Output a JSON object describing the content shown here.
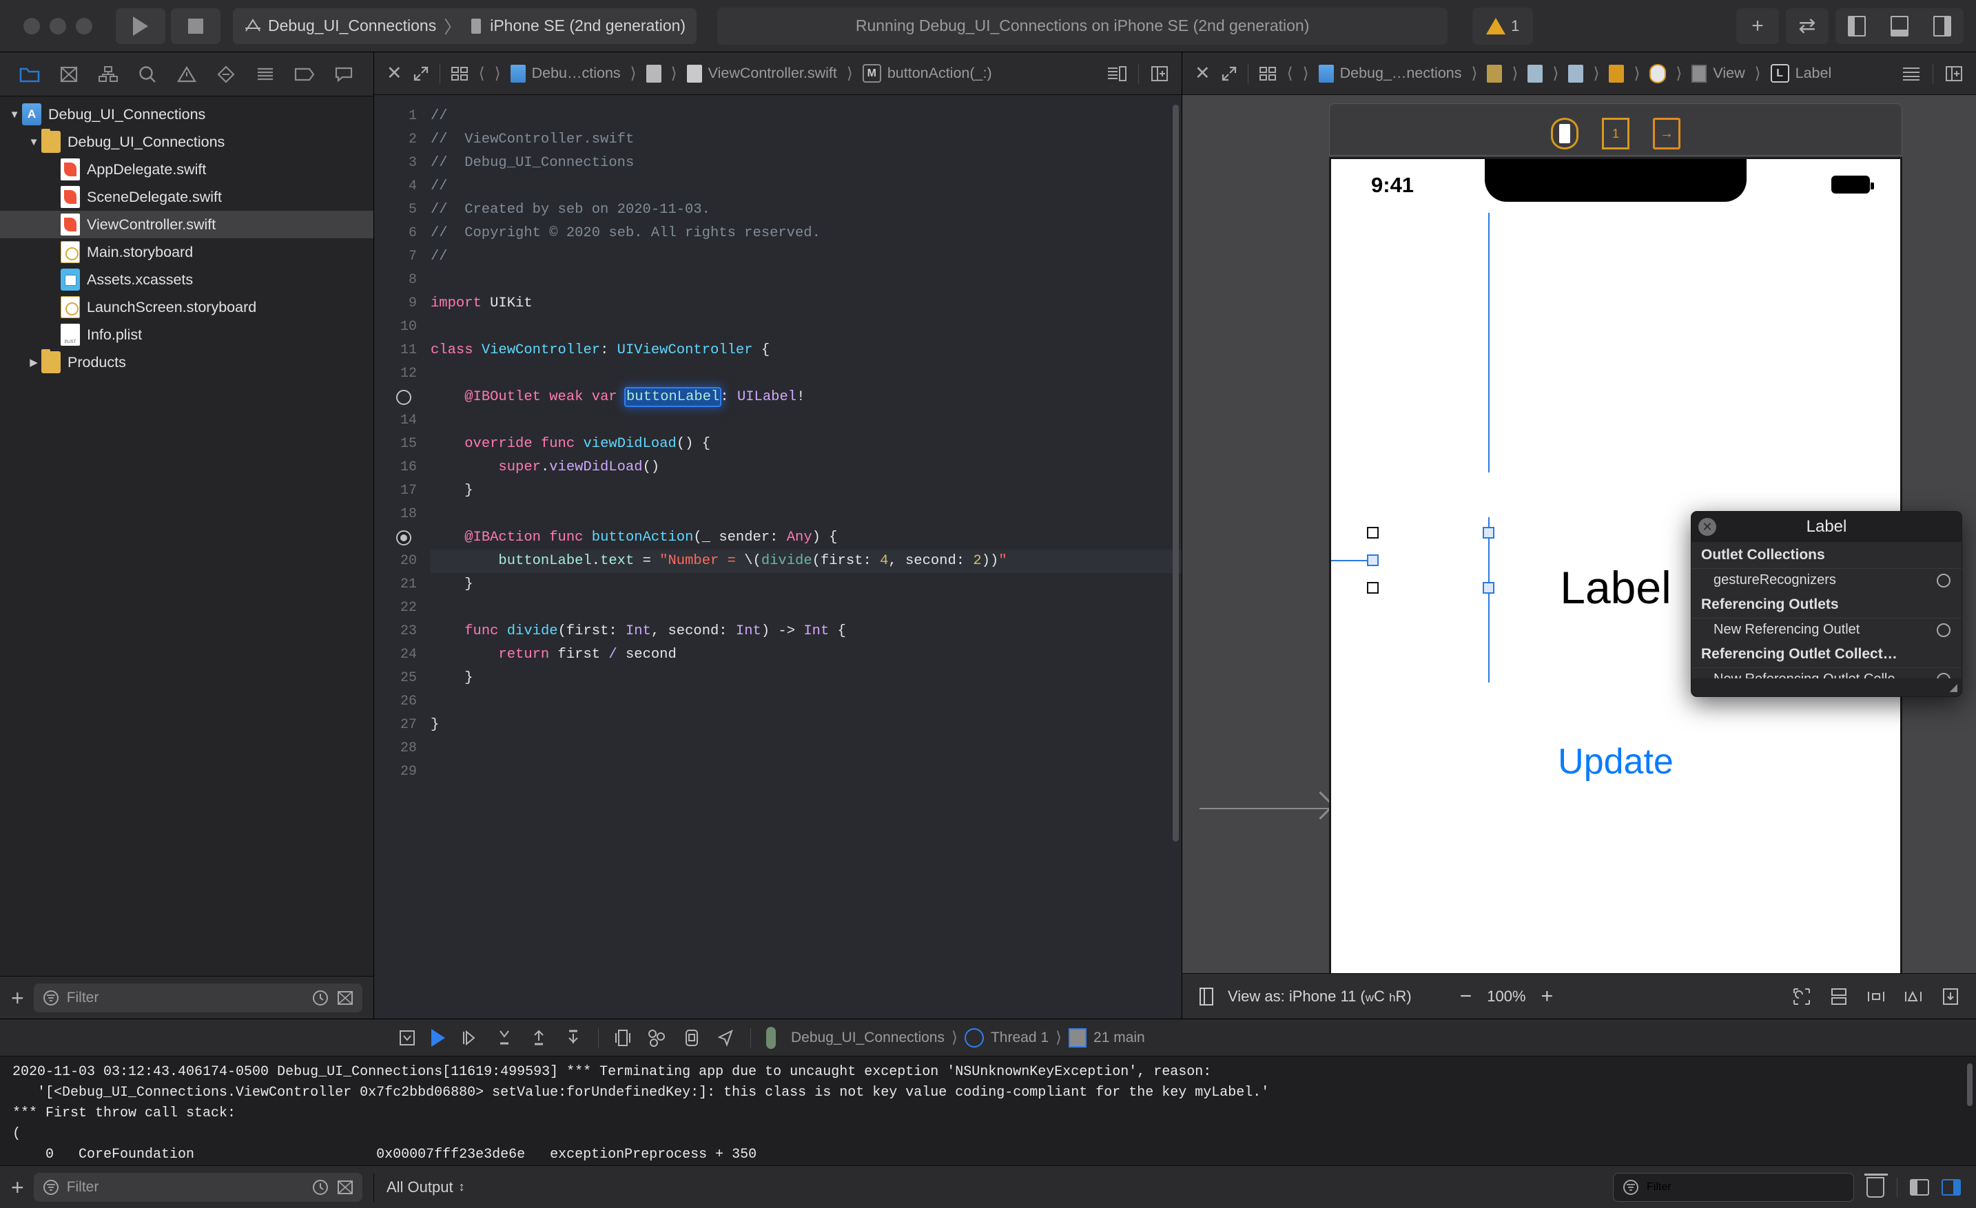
{
  "toolbar": {
    "run_icon": "play-icon",
    "stop_icon": "stop-icon",
    "scheme_name": "Debug_UI_Connections",
    "scheme_separator": "〉",
    "destination": "iPhone SE (2nd generation)",
    "status_text": "Running Debug_UI_Connections on iPhone SE (2nd generation)",
    "warning_count": "1",
    "add_label": "+",
    "swap_label": "⇄",
    "panes": [
      "left-pane-toggle",
      "bottom-pane-toggle",
      "right-pane-toggle"
    ]
  },
  "navigator": {
    "tabs": [
      "project-navigator-icon",
      "source-control-navigator-icon",
      "symbol-navigator-icon",
      "find-navigator-icon",
      "issue-navigator-icon",
      "test-navigator-icon",
      "debug-navigator-icon",
      "breakpoint-navigator-icon",
      "report-navigator-icon"
    ],
    "active_tab_index": 0,
    "tree": [
      {
        "label": "Debug_UI_Connections",
        "icon": "project-icon",
        "depth": 0,
        "disclosure": "▼",
        "selected": false
      },
      {
        "label": "Debug_UI_Connections",
        "icon": "folder-icon",
        "depth": 1,
        "disclosure": "▼",
        "selected": false
      },
      {
        "label": "AppDelegate.swift",
        "icon": "swift-file-icon",
        "depth": 2,
        "disclosure": "",
        "selected": false
      },
      {
        "label": "SceneDelegate.swift",
        "icon": "swift-file-icon",
        "depth": 2,
        "disclosure": "",
        "selected": false
      },
      {
        "label": "ViewController.swift",
        "icon": "swift-file-icon",
        "depth": 2,
        "disclosure": "",
        "selected": true
      },
      {
        "label": "Main.storyboard",
        "icon": "storyboard-icon",
        "depth": 2,
        "disclosure": "",
        "selected": false
      },
      {
        "label": "Assets.xcassets",
        "icon": "assets-icon",
        "depth": 2,
        "disclosure": "",
        "selected": false
      },
      {
        "label": "LaunchScreen.storyboard",
        "icon": "storyboard-icon",
        "depth": 2,
        "disclosure": "",
        "selected": false
      },
      {
        "label": "Info.plist",
        "icon": "plist-icon",
        "depth": 2,
        "disclosure": "",
        "selected": false
      },
      {
        "label": "Products",
        "icon": "folder-icon",
        "depth": 1,
        "disclosure": "▶",
        "selected": false
      }
    ],
    "footer": {
      "add_label": "+",
      "filter_placeholder": "Filter"
    }
  },
  "editor": {
    "jumpbar": {
      "close_label": "✕",
      "crumbs": [
        "Debu…ctions",
        "",
        "ViewController.swift",
        "buttonAction(_:)"
      ],
      "member_badge": "M"
    },
    "gutter_markers": {
      "ibo_line": 13,
      "iba_line": 19
    },
    "highlight_line": 20,
    "lines": [
      {
        "n": "1",
        "t": "//"
      },
      {
        "n": "2",
        "t": "//  ViewController.swift"
      },
      {
        "n": "3",
        "t": "//  Debug_UI_Connections"
      },
      {
        "n": "4",
        "t": "//"
      },
      {
        "n": "5",
        "t": "//  Created by seb on 2020-11-03."
      },
      {
        "n": "6",
        "t": "//  Copyright © 2020 seb. All rights reserved."
      },
      {
        "n": "7",
        "t": "//"
      },
      {
        "n": "8",
        "t": ""
      },
      {
        "n": "9",
        "t": "import UIKit"
      },
      {
        "n": "10",
        "t": ""
      },
      {
        "n": "11",
        "t": "class ViewController: UIViewController {"
      },
      {
        "n": "12",
        "t": ""
      },
      {
        "n": "13",
        "t": "    @IBOutlet weak var buttonLabel: UILabel!"
      },
      {
        "n": "14",
        "t": ""
      },
      {
        "n": "15",
        "t": "    override func viewDidLoad() {"
      },
      {
        "n": "16",
        "t": "        super.viewDidLoad()"
      },
      {
        "n": "17",
        "t": "    }"
      },
      {
        "n": "18",
        "t": ""
      },
      {
        "n": "19",
        "t": "    @IBAction func buttonAction(_ sender: Any) {"
      },
      {
        "n": "20",
        "t": "        buttonLabel.text = \"Number = \\(divide(first: 4, second: 2))\""
      },
      {
        "n": "21",
        "t": "    }"
      },
      {
        "n": "22",
        "t": ""
      },
      {
        "n": "23",
        "t": "    func divide(first: Int, second: Int) -> Int {"
      },
      {
        "n": "24",
        "t": "        return first / second"
      },
      {
        "n": "25",
        "t": "    }"
      },
      {
        "n": "26",
        "t": ""
      },
      {
        "n": "27",
        "t": "}"
      },
      {
        "n": "28",
        "t": ""
      },
      {
        "n": "29",
        "t": ""
      }
    ],
    "selected_token": "buttonLabel"
  },
  "interface_builder": {
    "jumpbar": {
      "close_label": "✕",
      "crumbs": [
        "Debug_…nections",
        "",
        "",
        "",
        "",
        "",
        "View",
        "Label"
      ],
      "label_badge": "L"
    },
    "scene_icons": [
      "view-controller-icon",
      "first-responder-icon",
      "exit-icon"
    ],
    "device": {
      "time": "9:41",
      "label_text": "Label",
      "button_text": "Update"
    },
    "bottom": {
      "view_as": "View as: iPhone 11 (",
      "view_as_w": "w",
      "view_as_c": "C",
      "view_as_h": "h",
      "view_as_r": "R)",
      "zoom_out": "−",
      "zoom_value": "100%",
      "zoom_in": "+"
    },
    "popover": {
      "title": "Label",
      "close_icon": "close-icon",
      "groups": [
        {
          "heading": "Outlet Collections",
          "items": [
            {
              "label": "gestureRecognizers"
            }
          ]
        },
        {
          "heading": "Referencing Outlets",
          "items": [
            {
              "label": "New Referencing Outlet"
            }
          ]
        },
        {
          "heading": "Referencing Outlet Collect…",
          "items": [
            {
              "label": "New Referencing Outlet Colle…"
            }
          ]
        }
      ]
    }
  },
  "debug": {
    "toolbar": {
      "icons": [
        "hide-debug-icon",
        "continue-icon",
        "step-over-icon",
        "step-into-icon",
        "step-out-icon",
        "step-out-of-icon",
        "view-debug-icon",
        "memory-graph-icon",
        "simulate-location-icon"
      ],
      "process": "Debug_UI_Connections",
      "thread": "Thread 1",
      "frame": "21 main"
    },
    "console_lines": [
      "2020-11-03 03:12:43.406174-0500 Debug_UI_Connections[11619:499593] *** Terminating app due to uncaught exception 'NSUnknownKeyException', reason:",
      "   '[<Debug_UI_Connections.ViewController 0x7fc2bbd06880> setValue:forUndefinedKey:]: this class is not key value coding-compliant for the key myLabel.'",
      "*** First throw call stack:",
      "(",
      "    0   CoreFoundation                      0x00007fff23e3de6e   exceptionPreprocess + 350"
    ],
    "output_filter_label": "All Output",
    "output_filter_chevron": "⌃⌄",
    "filter_placeholder": "Filter"
  },
  "colors": {
    "accent_blue": "#2878d0",
    "warning_yellow": "#e3a422",
    "swift_orange": "#f05138",
    "constraint_blue": "#2a7ae2",
    "button_blue": "#0b7bff"
  }
}
